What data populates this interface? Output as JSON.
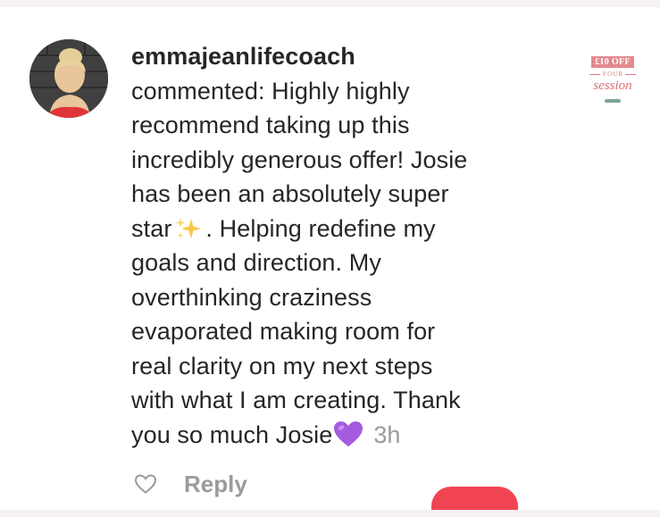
{
  "comment": {
    "username": "emmajeanlifecoach",
    "lines_before_sparkle": "commented: Highly highly\nrecommend taking up this\nincredibly generous offer! Josie\nhas been an absolutely super\nstar",
    "sparkle_icon": "sparkles-emoji",
    "lines_after_sparkle": ". Helping redefine my\ngoals and direction. My\noverthinking craziness\nevaporated making room for\nreal clarity on my next steps\nwith what I am creating. Thank\nyou so much Josie",
    "heart_icon": "purple-heart-emoji",
    "timestamp": "3h"
  },
  "actions": {
    "like_icon": "heart-outline-icon",
    "reply_label": "Reply"
  },
  "post_thumbnail": {
    "offer": "£10 OFF",
    "your": "YOUR",
    "session": "session"
  },
  "colors": {
    "text": "#262626",
    "muted": "#9b9b9b",
    "accent": "#f04452",
    "purple_heart": "#a45be0"
  }
}
